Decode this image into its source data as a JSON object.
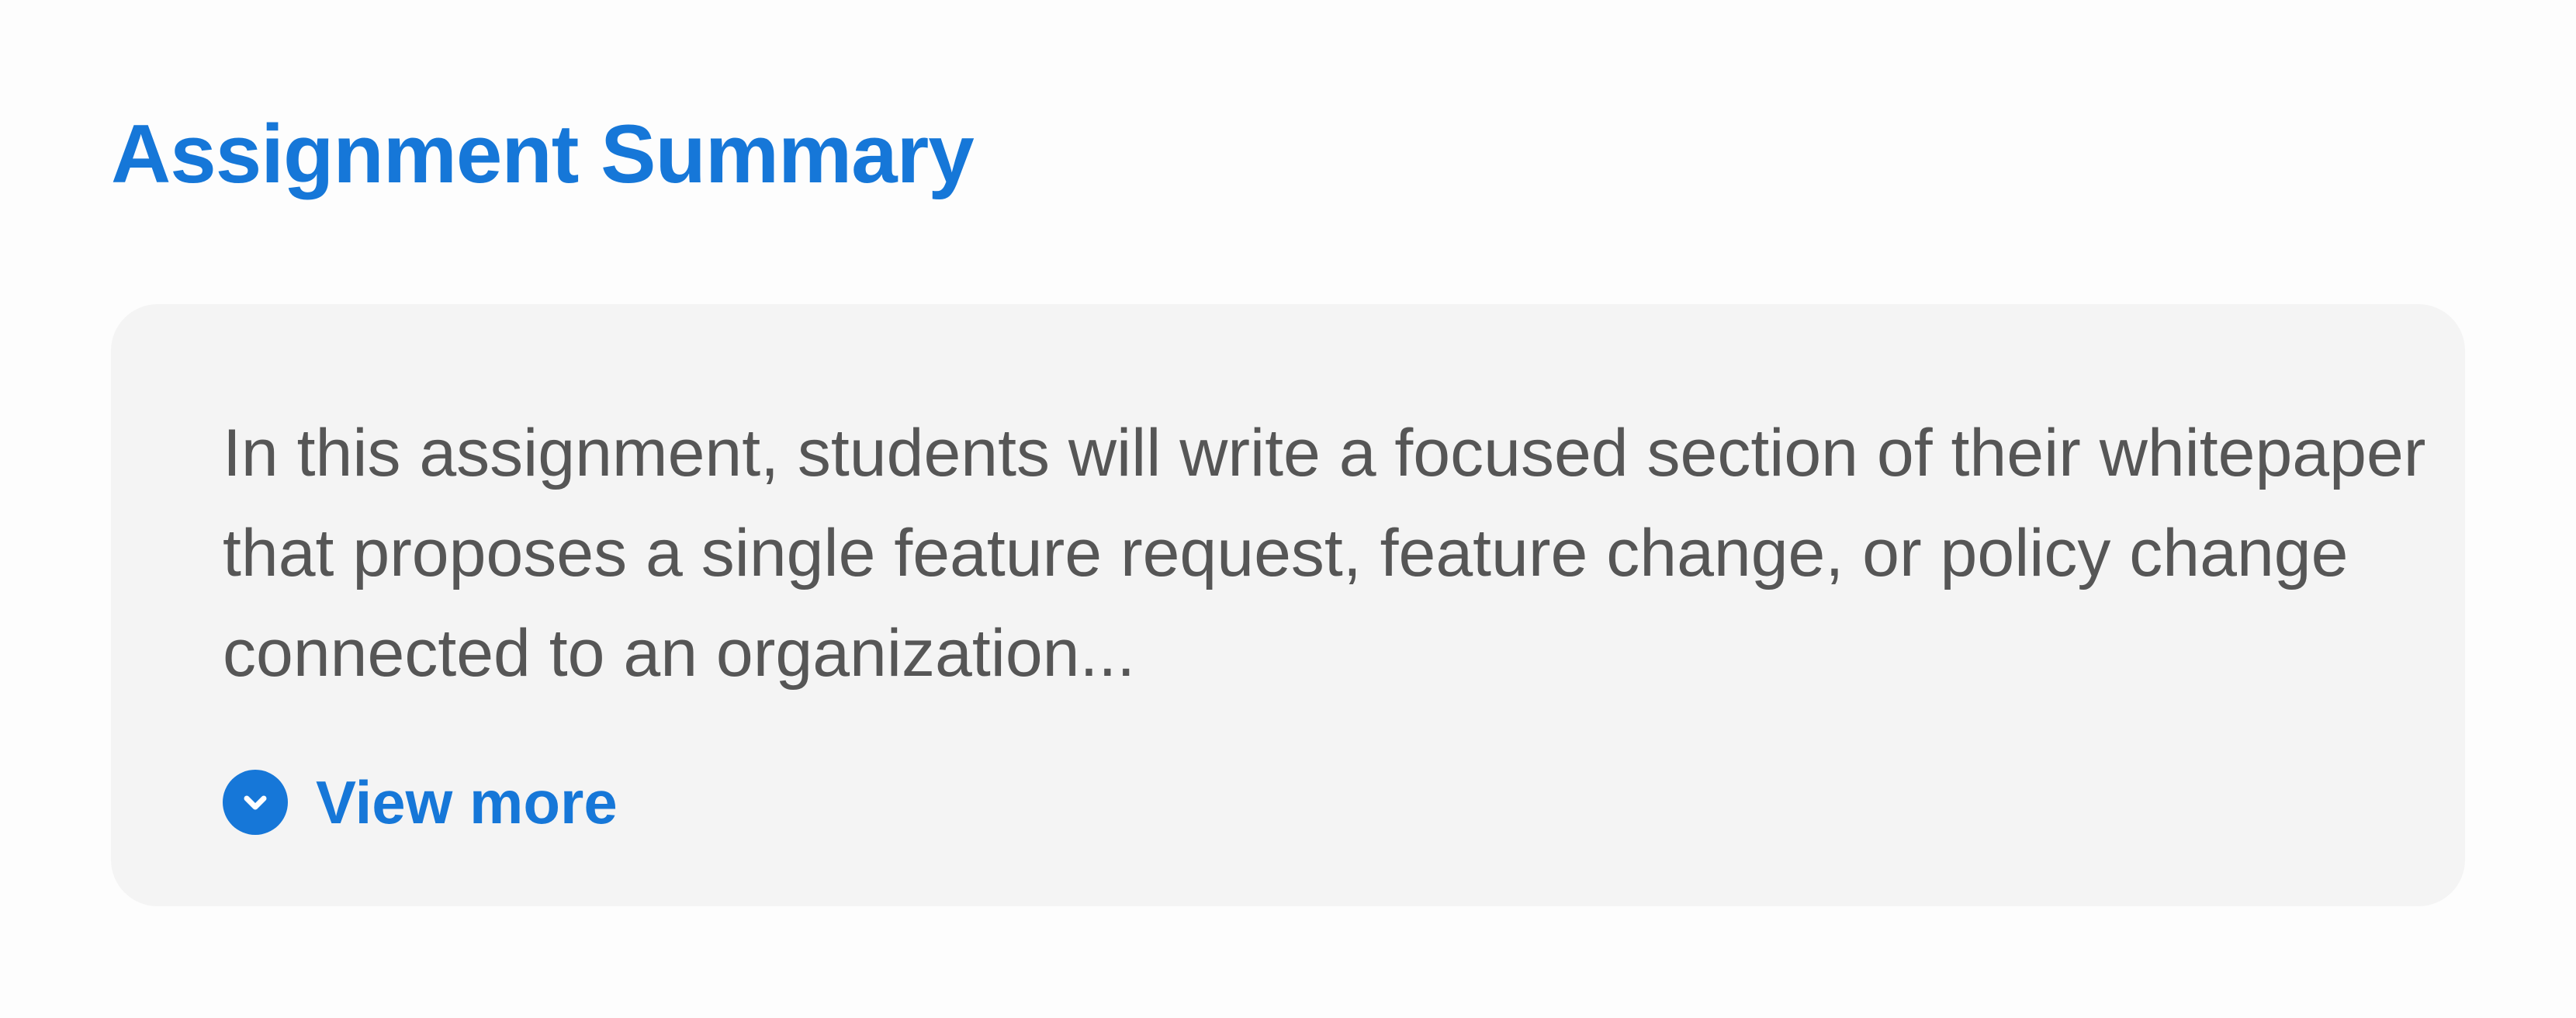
{
  "header": {
    "title": "Assignment Summary"
  },
  "summary_card": {
    "text": "In this assignment, students will write a focused section of their whitepaper that proposes a single feature request, feature change, or policy change connected to an organization...",
    "view_more_label": "View more",
    "view_more_icon": "chevron-down-icon"
  },
  "colors": {
    "accent": "#1677d8",
    "card_background": "#f4f4f4",
    "body_text": "#565656",
    "page_background": "#fdfdfd"
  }
}
